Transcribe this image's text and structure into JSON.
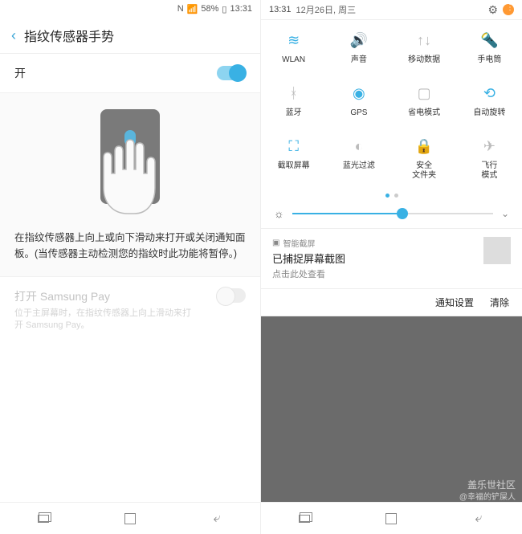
{
  "left": {
    "status": {
      "nfc": "N",
      "signal": "📶",
      "battery": "58%",
      "time": "13:31"
    },
    "header": {
      "title": "指纹传感器手势"
    },
    "toggle_row": {
      "label": "开"
    },
    "description": "在指纹传感器上向上或向下滑动来打开或关闭通知面板。(当传感器主动检测您的指纹时此功能将暂停。)",
    "samsung_pay": {
      "title": "打开 Samsung Pay",
      "sub": "位于主屏幕时，在指纹传感器上向上滑动来打开 Samsung Pay。"
    }
  },
  "right": {
    "status": {
      "time": "13:31",
      "date": "12月26日, 周三"
    },
    "qs": [
      {
        "icon": "wifi",
        "label": "WLAN",
        "active": true,
        "glyph": "≋"
      },
      {
        "icon": "sound",
        "label": "声音",
        "active": true,
        "glyph": "🔊"
      },
      {
        "icon": "data",
        "label": "移动数据",
        "active": false,
        "glyph": "↑↓"
      },
      {
        "icon": "flash",
        "label": "手电筒",
        "active": false,
        "glyph": "🔦"
      },
      {
        "icon": "bt",
        "label": "蓝牙",
        "active": false,
        "glyph": "ᚼ"
      },
      {
        "icon": "gps",
        "label": "GPS",
        "active": true,
        "glyph": "◉"
      },
      {
        "icon": "power",
        "label": "省电模式",
        "active": false,
        "glyph": "▢"
      },
      {
        "icon": "rotate",
        "label": "自动旋转",
        "active": true,
        "glyph": "⟲"
      },
      {
        "icon": "capture",
        "label": "截取屏幕",
        "active": true,
        "glyph": "⛶"
      },
      {
        "icon": "blue",
        "label": "蓝光过滤",
        "active": false,
        "glyph": "◐"
      },
      {
        "icon": "secure",
        "label": "安全\n文件夹",
        "active": false,
        "glyph": "🔒"
      },
      {
        "icon": "plane",
        "label": "飞行\n模式",
        "active": false,
        "glyph": "✈"
      }
    ],
    "notif": {
      "app": "智能截屏",
      "title": "已捕捉屏幕截图",
      "sub": "点击此处查看"
    },
    "actions": {
      "settings": "通知设置",
      "clear": "清除"
    }
  },
  "watermark": {
    "main": "盖乐世社区",
    "sub": "@幸福的铲屎人"
  }
}
